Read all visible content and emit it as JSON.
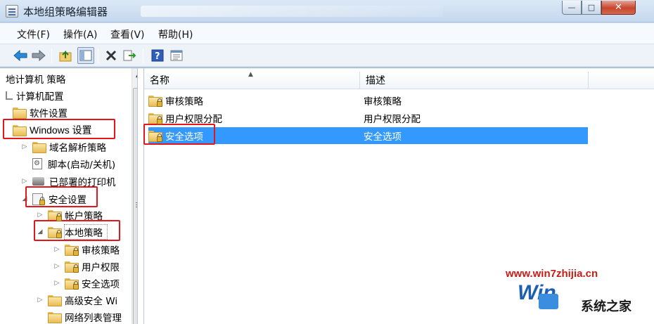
{
  "window": {
    "title": "本地组策略编辑器",
    "min_glyph": "—",
    "max_glyph": "□",
    "close_glyph": "✕"
  },
  "menu": [
    "文件(F)",
    "操作(A)",
    "查看(V)",
    "帮助(H)"
  ],
  "toolbar": {
    "icons": [
      "back-arrow-icon",
      "forward-arrow-icon",
      "up-folder-icon",
      "show-hide-tree-icon",
      "delete-icon",
      "export-list-icon",
      "help-icon",
      "properties-icon"
    ]
  },
  "tree": {
    "root": "地计算机 策略",
    "computer_config": "计算机配置",
    "software": "软件设置",
    "windows_settings": "Windows 设置",
    "dns": "域名解析策略",
    "scripts": "脚本(启动/关机)",
    "printers": "已部署的打印机",
    "security_settings": "安全设置",
    "account_policies": "帐户策略",
    "local_policies": "本地策略",
    "audit": "审核策略",
    "user_rights": "用户权限",
    "security_options": "安全选项",
    "advanced_security": "高级安全 Wi",
    "network_list": "网络列表管理"
  },
  "list": {
    "col_name": "名称",
    "col_desc": "描述",
    "rows": [
      {
        "name": "审核策略",
        "desc": "审核策略"
      },
      {
        "name": "用户权限分配",
        "desc": "用户权限分配"
      },
      {
        "name": "安全选项",
        "desc": "安全选项"
      }
    ],
    "selected_index": 2
  },
  "watermark": {
    "url": "www.win7zhijia.cn",
    "logo_text": "系统之家",
    "logo_win": "Win"
  },
  "colors": {
    "selection": "#3399ff",
    "annotation_red": "#e3161c"
  }
}
